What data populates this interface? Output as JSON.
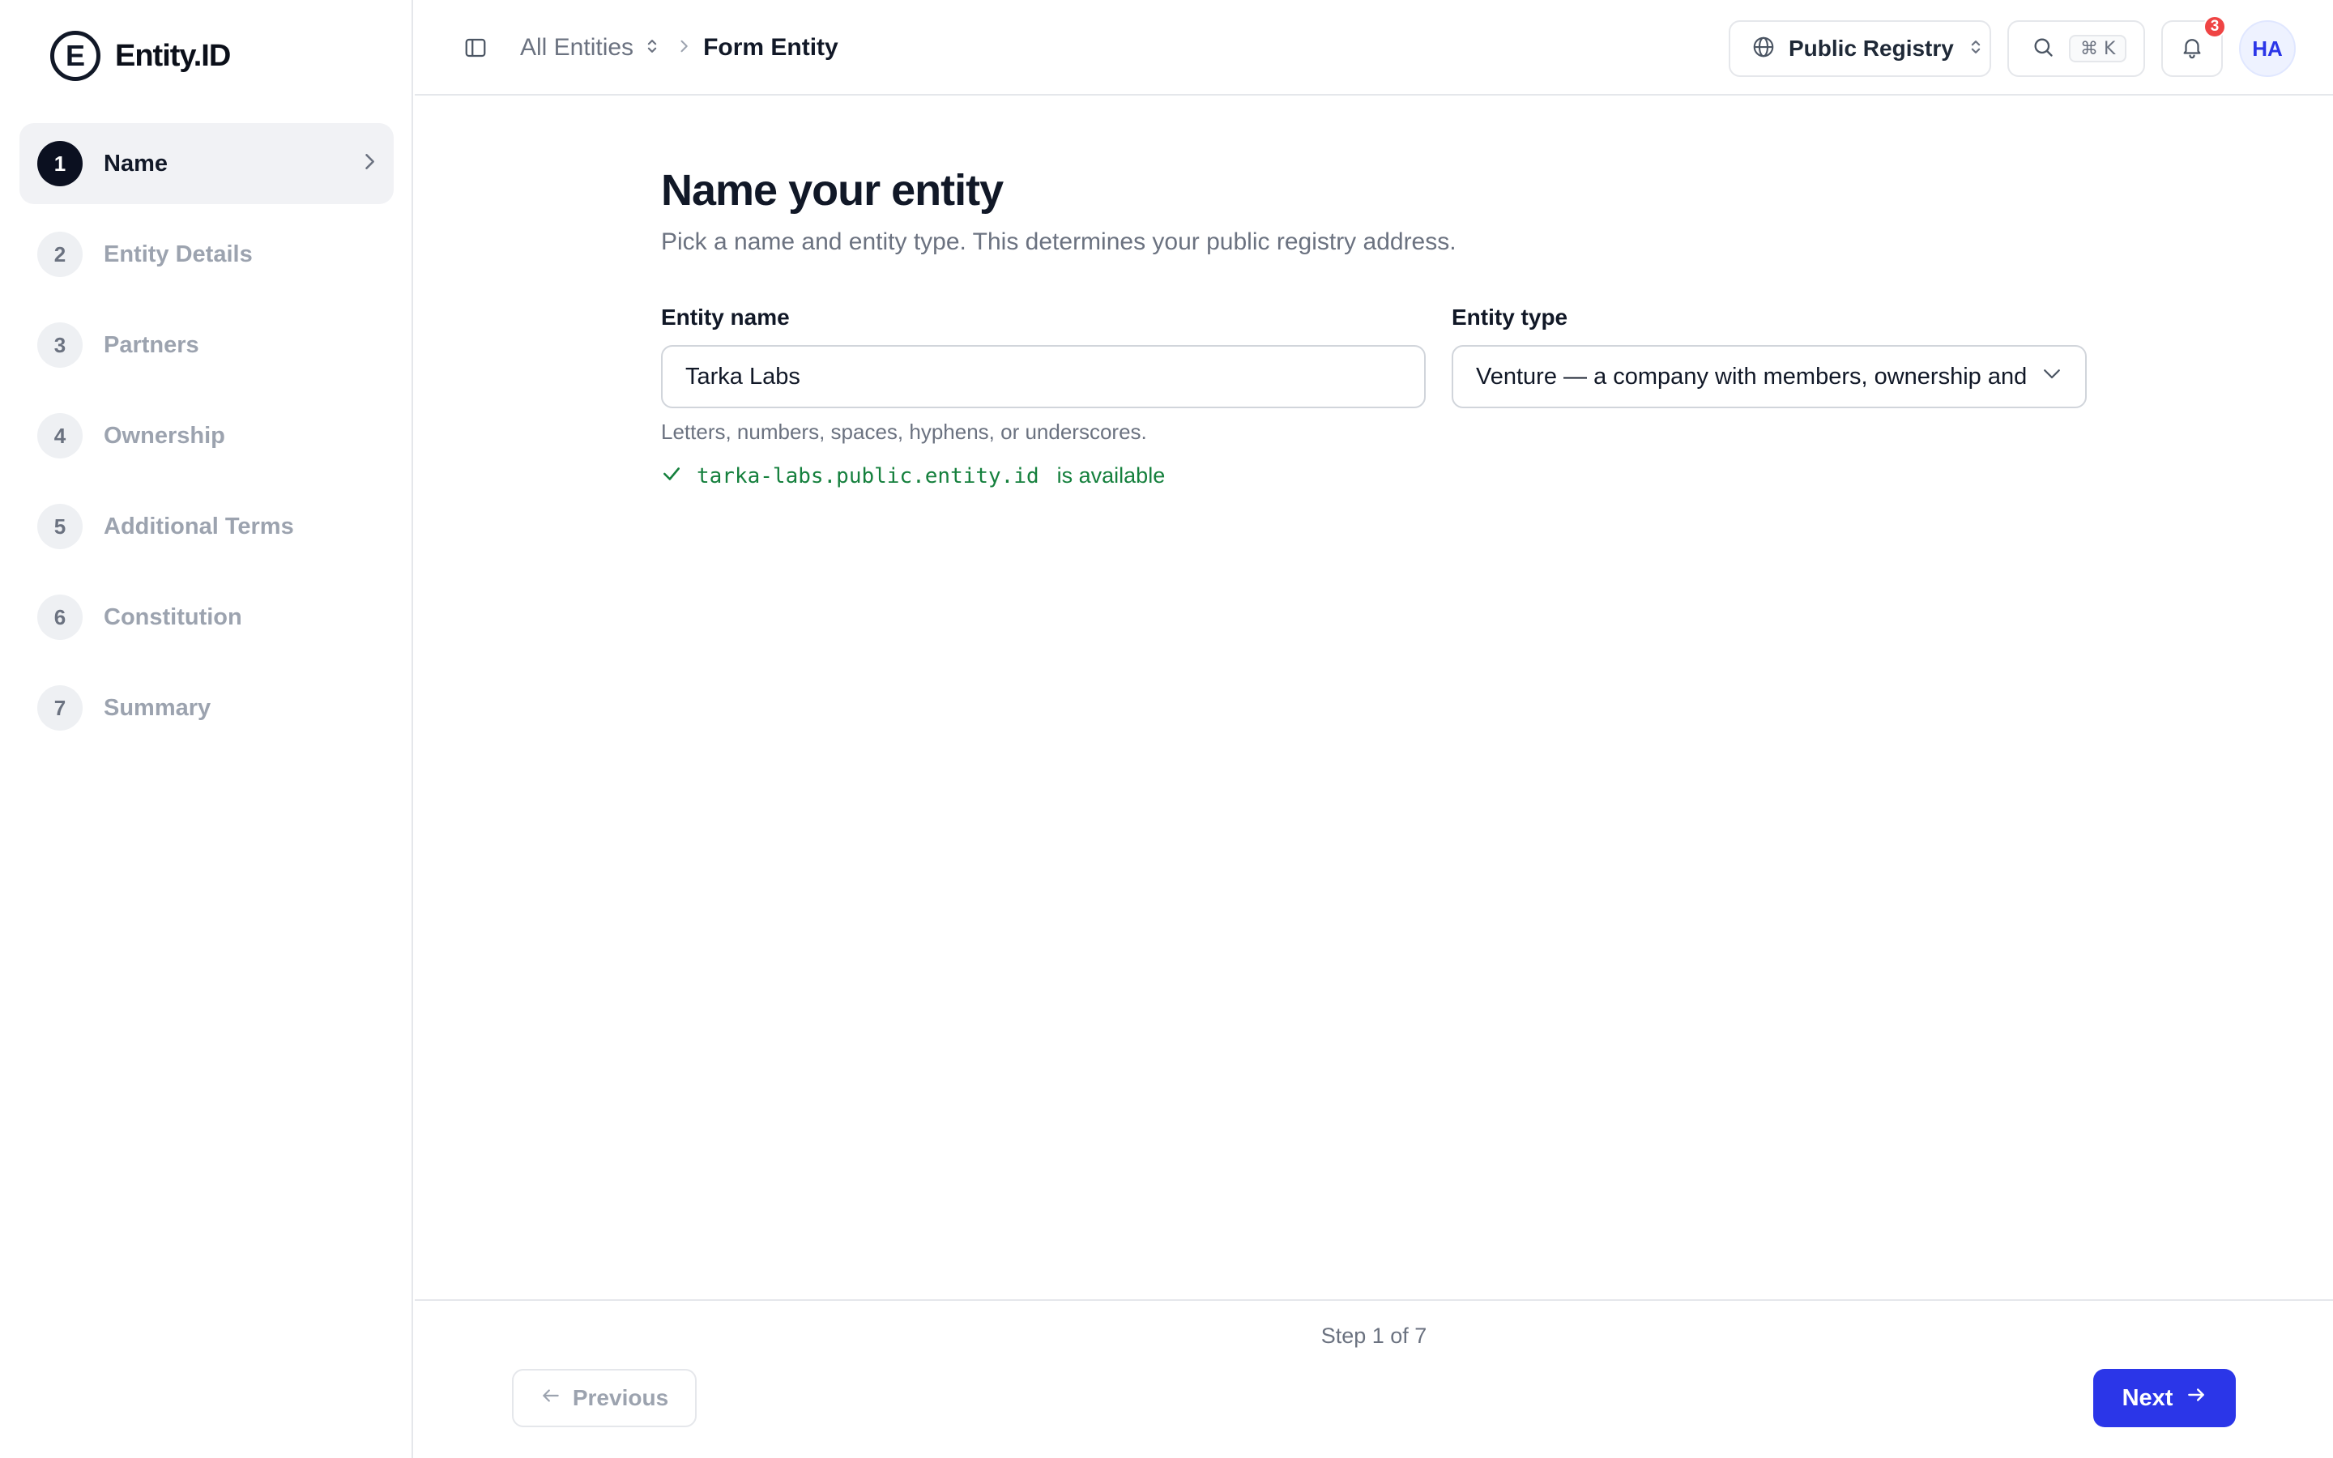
{
  "app": {
    "logo_letter": "E",
    "logo_text": "Entity.ID"
  },
  "sidebar": {
    "steps": [
      {
        "number": "1",
        "label": "Name",
        "active": true
      },
      {
        "number": "2",
        "label": "Entity Details",
        "active": false
      },
      {
        "number": "3",
        "label": "Partners",
        "active": false
      },
      {
        "number": "4",
        "label": "Ownership",
        "active": false
      },
      {
        "number": "5",
        "label": "Additional Terms",
        "active": false
      },
      {
        "number": "6",
        "label": "Constitution",
        "active": false
      },
      {
        "number": "7",
        "label": "Summary",
        "active": false
      }
    ]
  },
  "header": {
    "breadcrumb": {
      "parent": "All Entities",
      "current": "Form Entity"
    },
    "registry_label": "Public Registry",
    "search_shortcut": "⌘ K",
    "notification_count": "3",
    "avatar_initials": "HA"
  },
  "form": {
    "title": "Name your entity",
    "subtitle": "Pick a name and entity type. This determines your public registry address.",
    "name_label": "Entity name",
    "name_value": "Tarka Labs",
    "type_label": "Entity type",
    "type_value": "Venture — a company with members, ownership and",
    "hint": "Letters, numbers, spaces, hyphens, or underscores.",
    "availability_domain": "tarka-labs.public.entity.id",
    "availability_text": "is available"
  },
  "footer": {
    "step_indicator": "Step 1 of 7",
    "previous_label": "Previous",
    "next_label": "Next"
  },
  "colors": {
    "accent": "#2b36e8",
    "success": "#15803d",
    "badge": "#ef4444",
    "active_step": "#0b1020"
  }
}
